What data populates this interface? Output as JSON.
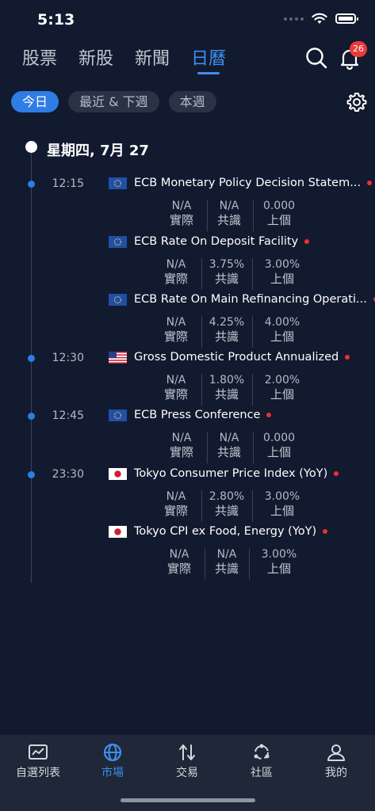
{
  "status": {
    "time": "5:13"
  },
  "top_tabs": [
    {
      "label": "股票"
    },
    {
      "label": "新股"
    },
    {
      "label": "新聞"
    },
    {
      "label": "日曆",
      "active": true
    }
  ],
  "notification_count": "26",
  "filters": [
    {
      "label": "今日",
      "active": true
    },
    {
      "label": "最近 & 下週"
    },
    {
      "label": "本週"
    }
  ],
  "date_label": "星期四, 7月 27",
  "value_labels": {
    "actual": "實際",
    "consensus": "共識",
    "previous": "上個"
  },
  "events": [
    {
      "time": "12:15",
      "flag": "eu",
      "title": "ECB Monetary Policy Decision Statem...",
      "actual": "N/A",
      "consensus": "N/A",
      "previous": "0.000"
    },
    {
      "time": "",
      "flag": "eu",
      "title": "ECB Rate On Deposit Facility",
      "actual": "N/A",
      "consensus": "3.75%",
      "previous": "3.00%"
    },
    {
      "time": "",
      "flag": "eu",
      "title": "ECB Rate On Main Refinancing Operati...",
      "actual": "N/A",
      "consensus": "4.25%",
      "previous": "4.00%"
    },
    {
      "time": "12:30",
      "flag": "us",
      "title": "Gross Domestic Product Annualized",
      "actual": "N/A",
      "consensus": "1.80%",
      "previous": "2.00%"
    },
    {
      "time": "12:45",
      "flag": "eu",
      "title": "ECB Press Conference",
      "actual": "N/A",
      "consensus": "N/A",
      "previous": "0.000"
    },
    {
      "time": "23:30",
      "flag": "jp",
      "title": "Tokyo Consumer Price Index (YoY)",
      "actual": "N/A",
      "consensus": "2.80%",
      "previous": "3.00%"
    },
    {
      "time": "",
      "flag": "jp",
      "title": "Tokyo CPI ex Food, Energy (YoY)",
      "actual": "N/A",
      "consensus": "N/A",
      "previous": "3.00%"
    }
  ],
  "bottom_nav": [
    {
      "label": "自選列表",
      "icon": "chart-icon"
    },
    {
      "label": "市場",
      "icon": "globe-icon",
      "active": true
    },
    {
      "label": "交易",
      "icon": "swap-arrows-icon"
    },
    {
      "label": "社區",
      "icon": "community-icon"
    },
    {
      "label": "我的",
      "icon": "person-icon"
    }
  ],
  "colors": {
    "background": "#121a2f",
    "accent": "#3e8ff0",
    "important": "#ee3030",
    "badge": "#ec3a3a"
  }
}
